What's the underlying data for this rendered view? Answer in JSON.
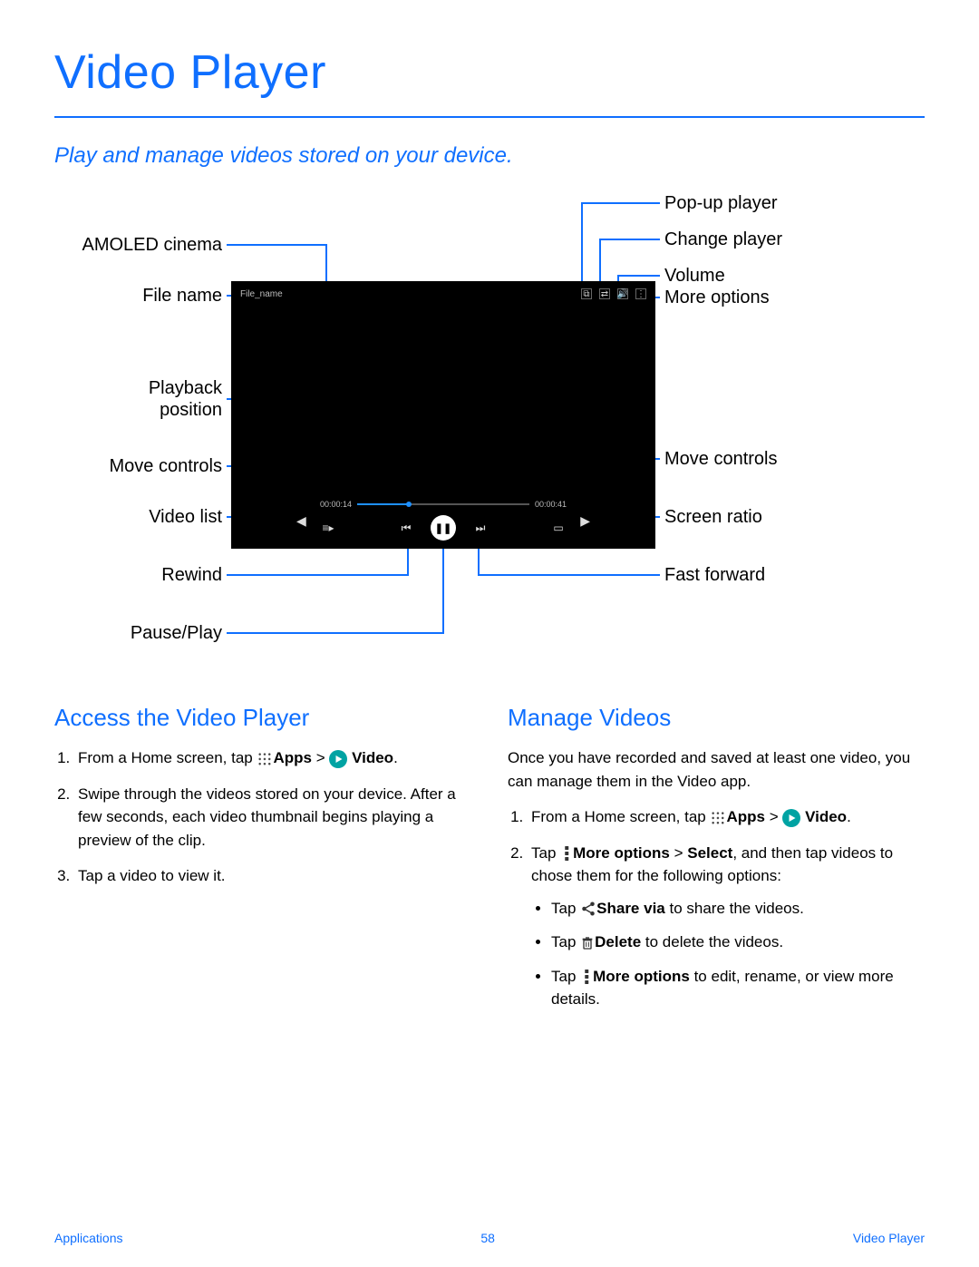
{
  "page": {
    "title": "Video Player",
    "subtitle": "Play and manage videos stored on your device."
  },
  "diagram": {
    "left_labels": {
      "amoled": "AMOLED cinema",
      "file_name": "File name",
      "playback_position": "Playback\nposition",
      "move_controls": "Move controls",
      "video_list": "Video list",
      "rewind": "Rewind",
      "pause_play": "Pause/Play"
    },
    "right_labels": {
      "popup_player": "Pop-up player",
      "change_player": "Change player",
      "volume": "Volume",
      "more_options": "More options",
      "move_controls": "Move controls",
      "screen_ratio": "Screen ratio",
      "fast_forward": "Fast forward"
    },
    "player": {
      "file_name": "File_name",
      "time_current": "00:00:14",
      "time_total": "00:00:41"
    }
  },
  "sections": {
    "access": {
      "heading": "Access the Video Player",
      "steps": {
        "s1_pre": "From a Home screen, tap ",
        "apps_label": "Apps",
        "gt": " > ",
        "video_label": "Video",
        "period": ".",
        "s2": "Swipe through the videos stored on your device. After a few seconds, each video thumbnail begins playing a preview of the clip.",
        "s3": "Tap a video to view it."
      }
    },
    "manage": {
      "heading": "Manage Videos",
      "intro": "Once you have recorded and saved at least one video, you can manage them in the Video app.",
      "steps": {
        "s1_pre": "From a Home screen, tap ",
        "apps_label": "Apps",
        "gt": " > ",
        "video_label": "Video",
        "period": ".",
        "s2_pre": "Tap ",
        "s2_more": "More options",
        "s2_gt": " > ",
        "s2_select": "Select",
        "s2_post": ", and then tap videos to chose them for the following options:",
        "b1_pre": "Tap ",
        "b1_label": "Share via",
        "b1_post": " to share the videos.",
        "b2_pre": "Tap ",
        "b2_label": "Delete",
        "b2_post": "  to delete the videos.",
        "b3_pre": "Tap ",
        "b3_label": "More options",
        "b3_post": " to edit, rename, or view more details."
      }
    }
  },
  "footer": {
    "left": "Applications",
    "center": "58",
    "right": "Video Player"
  }
}
